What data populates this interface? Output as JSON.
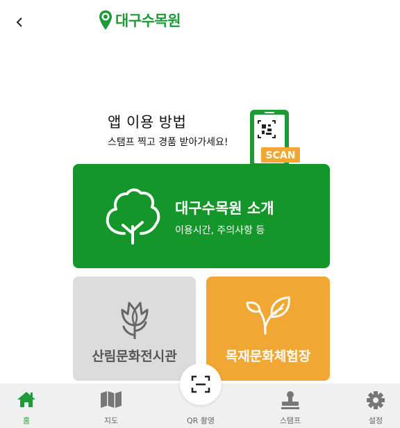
{
  "header": {
    "logo_text": "대구수목원",
    "brand_color": "#1e9a37"
  },
  "howto": {
    "title": "앱 이용 방법",
    "subtitle": "스탬프 찍고 경품 받아가세요!",
    "scan_label": "SCAN"
  },
  "cards": {
    "intro": {
      "title": "대구수목원 소개",
      "subtitle": "이용시간, 주의사항 등",
      "color": "#15962a"
    },
    "forest": {
      "title": "산림문화전시관",
      "color": "#dcdcdc"
    },
    "wood": {
      "title": "목재문화체험장",
      "color": "#f1a733"
    }
  },
  "bottom_nav": {
    "items": [
      {
        "label": "홈",
        "icon": "home-icon",
        "active": true
      },
      {
        "label": "지도",
        "icon": "map-icon"
      },
      {
        "label": "QR 촬영",
        "icon": "qr-scan-icon"
      },
      {
        "label": "스탬프",
        "icon": "stamp-icon"
      },
      {
        "label": "설정",
        "icon": "gear-icon"
      }
    ]
  }
}
